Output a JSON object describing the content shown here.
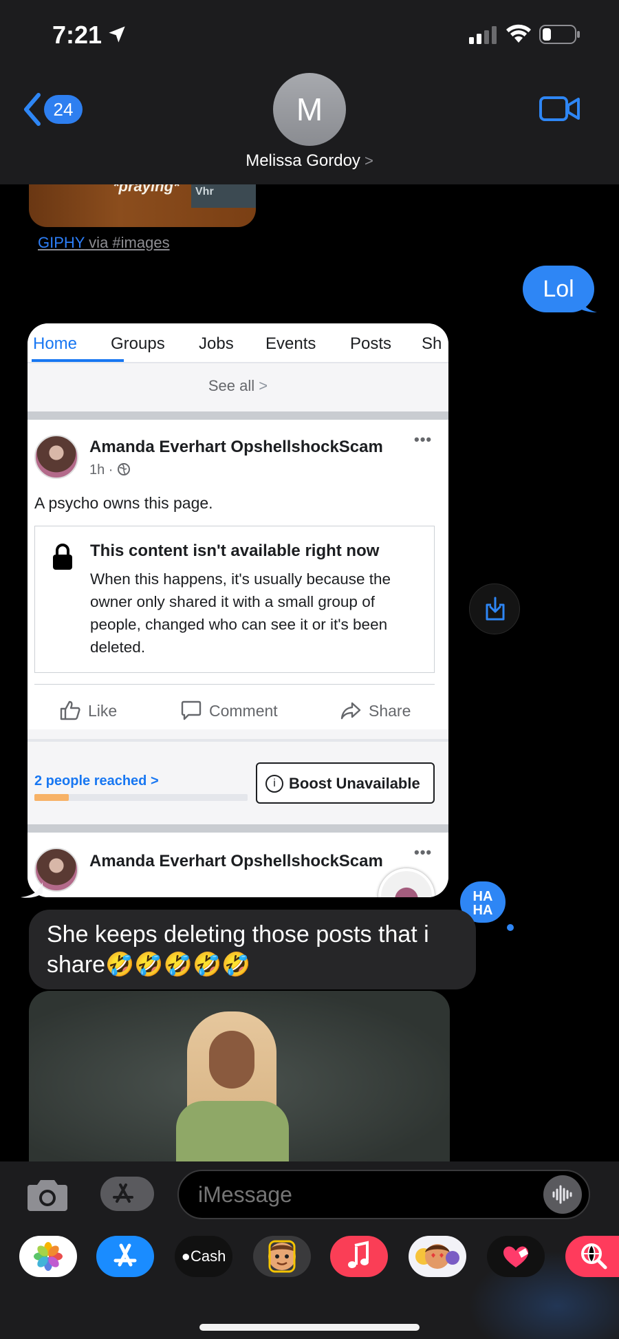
{
  "status_bar": {
    "time": "7:21"
  },
  "header": {
    "back_count": "24",
    "avatar_initial": "M",
    "contact_name": "Melissa Gordoy",
    "contact_chevron": ">"
  },
  "thread": {
    "gif_top": {
      "caption": "*praying*",
      "tag": "Vhr"
    },
    "giphy_link": {
      "brand": "GIPHY",
      "rest": " via #images"
    },
    "sent_message": "Lol",
    "screenshot": {
      "tabs": [
        "Home",
        "Groups",
        "Jobs",
        "Events",
        "Posts",
        "Sh"
      ],
      "active_tab": "Home",
      "see_all": "See all",
      "see_all_chevron": ">",
      "post": {
        "author": "Amanda Everhart OpshellshockScam",
        "time": "1h ·",
        "more": "•••",
        "text": "A psycho owns this page.",
        "unavailable_title": "This content isn't available right now",
        "unavailable_body": "When this happens, it's usually because the owner only shared it with a small group of people, changed who can see it or it's been deleted.",
        "actions": {
          "like": "Like",
          "comment": "Comment",
          "share": "Share"
        },
        "reached": "2 people reached",
        "reached_chevron": ">",
        "reach_progress": 0.16,
        "boost": "Boost Unavailable"
      },
      "next_post": {
        "author": "Amanda Everhart OpshellshockScam",
        "more": "•••"
      }
    },
    "tapback": {
      "line1": "HA",
      "line2": "HA"
    },
    "received_message": "She keeps deleting those posts that i share🤣🤣🤣🤣🤣"
  },
  "compose": {
    "placeholder": "iMessage"
  },
  "drawer": {
    "apps": [
      "photos-icon",
      "app-store-icon",
      "apple-cash-icon",
      "memoji-icon",
      "music-icon",
      "animoji-icon",
      "digital-touch-icon",
      "web-search-icon"
    ],
    "apple_cash_label": "Cash"
  },
  "colors": {
    "imessage_blue": "#2e86f5",
    "received_bubble": "#262628",
    "facebook_blue": "#1877f2",
    "header_bg": "#1c1c1e"
  }
}
